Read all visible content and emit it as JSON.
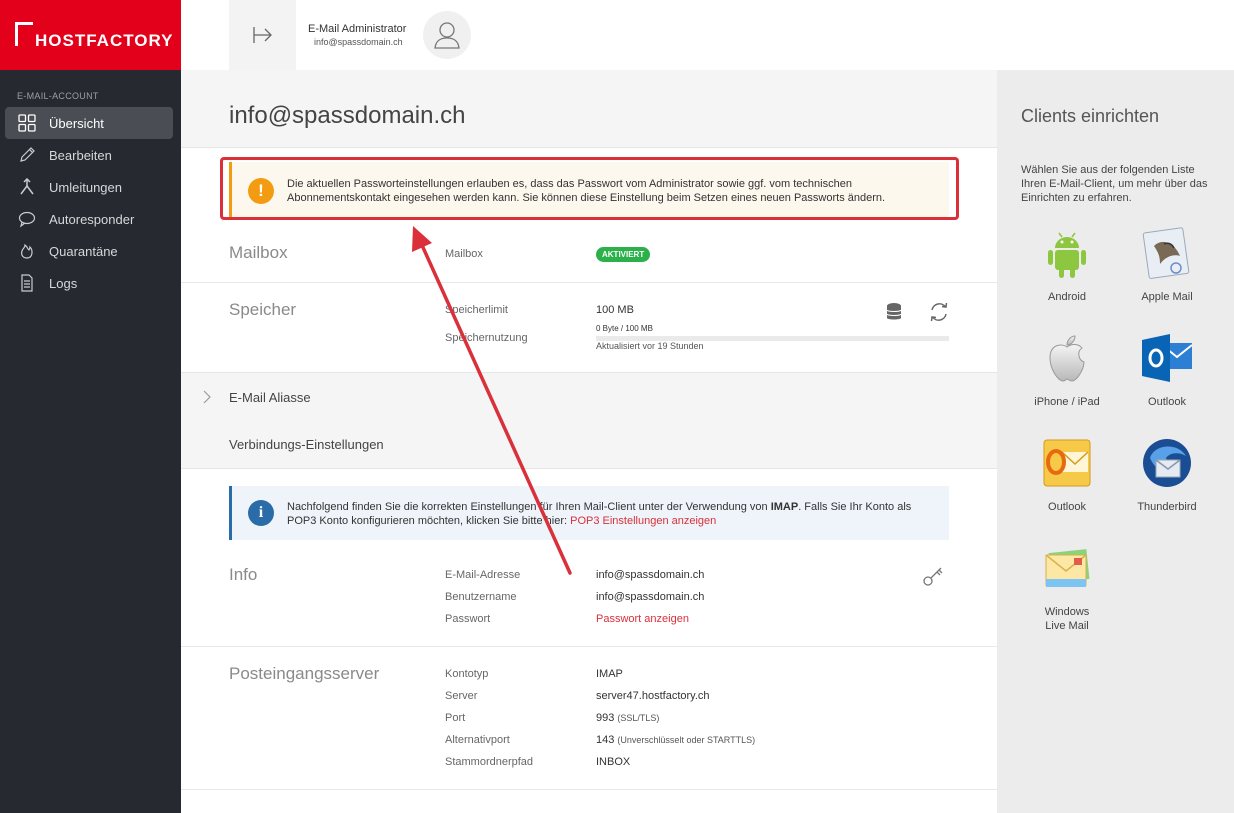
{
  "brand": {
    "name": "HOSTFACTORY",
    "color": "#e2001a"
  },
  "sidebar": {
    "section": "E-MAIL-ACCOUNT",
    "items": [
      {
        "label": "Übersicht",
        "icon": "grid-icon",
        "active": true
      },
      {
        "label": "Bearbeiten",
        "icon": "pencil-icon"
      },
      {
        "label": "Umleitungen",
        "icon": "fork-icon"
      },
      {
        "label": "Autoresponder",
        "icon": "chat-icon"
      },
      {
        "label": "Quarantäne",
        "icon": "flame-icon"
      },
      {
        "label": "Logs",
        "icon": "document-icon"
      }
    ]
  },
  "header": {
    "user_role": "E-Mail Administrator",
    "user_email": "info@spassdomain.ch"
  },
  "main": {
    "title": "info@spassdomain.ch",
    "warning": "Die aktuellen Passworteinstellungen erlauben es, dass das Passwort vom Administrator sowie ggf. vom technischen Abonnementskontakt eingesehen werden kann. Sie können diese Einstellung beim Setzen eines neuen Passworts ändern.",
    "mailbox": {
      "title": "Mailbox",
      "label": "Mailbox",
      "status": "AKTIVIERT"
    },
    "storage": {
      "title": "Speicher",
      "limit_label": "Speicherlimit",
      "limit_value": "100 MB",
      "usage_label": "Speichernutzung",
      "usage_value": "0 Byte / 100 MB",
      "usage_fraction": 0,
      "updated": "Aktualisiert vor 19 Stunden"
    },
    "aliases": {
      "title": "E-Mail Aliasse"
    },
    "connection": {
      "title": "Verbindungs-Einstellungen"
    },
    "info_box": {
      "part1": "Nachfolgend finden Sie die korrekten Einstellungen für Ihren Mail-Client unter der Verwendung von ",
      "protocol": "IMAP",
      "part2": ". Falls Sie Ihr Konto als POP3 Konto konfigurieren möchten, klicken Sie bitte hier: ",
      "link": "POP3 Einstellungen anzeigen"
    },
    "info": {
      "title": "Info",
      "rows": [
        {
          "label": "E-Mail-Adresse",
          "value": "info@spassdomain.ch"
        },
        {
          "label": "Benutzername",
          "value": "info@spassdomain.ch"
        },
        {
          "label": "Passwort",
          "value": "Passwort anzeigen"
        }
      ]
    },
    "incoming": {
      "title": "Posteingangsserver",
      "rows": [
        {
          "label": "Kontotyp",
          "value": "IMAP",
          "note": ""
        },
        {
          "label": "Server",
          "value": "server47.hostfactory.ch",
          "note": ""
        },
        {
          "label": "Port",
          "value": "993",
          "note": "(SSL/TLS)"
        },
        {
          "label": "Alternativport",
          "value": "143",
          "note": "(Unverschlüsselt oder STARTTLS)"
        },
        {
          "label": "Stammordnerpfad",
          "value": "INBOX",
          "note": ""
        }
      ]
    }
  },
  "right_panel": {
    "title": "Clients einrichten",
    "text": "Wählen Sie aus der folgenden Liste Ihren E-Mail-Client, um mehr über das Einrichten zu erfahren.",
    "clients": [
      {
        "name": "Android",
        "icon": "android-icon"
      },
      {
        "name": "Apple Mail",
        "icon": "apple-mail-icon"
      },
      {
        "name": "iPhone / iPad",
        "icon": "apple-icon"
      },
      {
        "name": "Outlook",
        "icon": "outlook-new-icon"
      },
      {
        "name": "Outlook",
        "icon": "outlook-old-icon"
      },
      {
        "name": "Thunderbird",
        "icon": "thunderbird-icon"
      },
      {
        "name": "Windows Live Mail",
        "icon": "windows-live-mail-icon"
      }
    ]
  },
  "colors": {
    "accent": "#e2001a",
    "warning": "#f39c12",
    "info": "#2a6ca8",
    "success": "#2bb04a",
    "annotation": "#d9303a"
  }
}
